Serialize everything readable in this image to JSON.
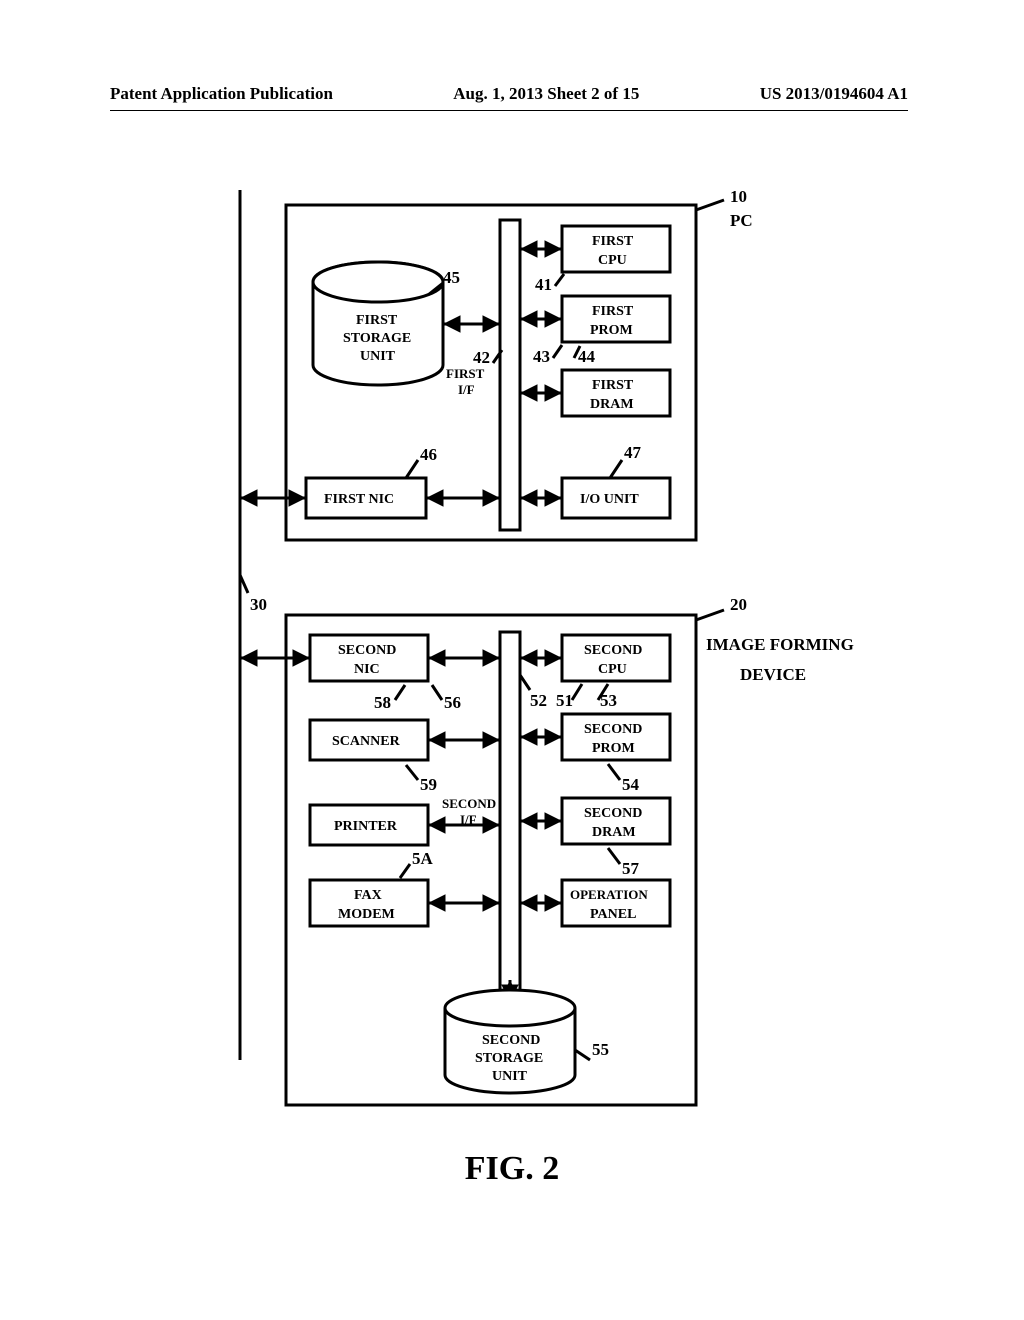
{
  "header": {
    "left": "Patent Application Publication",
    "center": "Aug. 1, 2013  Sheet 2 of 15",
    "right": "US 2013/0194604 A1"
  },
  "figure_caption": "FIG. 2",
  "diagram": {
    "network_ref": "30",
    "pc": {
      "ref": "10",
      "label": "PC",
      "interface": {
        "ref": "42",
        "label1": "FIRST",
        "label2": "I/F"
      },
      "storage": {
        "ref": "45",
        "label1": "FIRST",
        "label2": "STORAGE",
        "label3": "UNIT"
      },
      "cpu": {
        "ref": "41",
        "label1": "FIRST",
        "label2": "CPU"
      },
      "prom": {
        "ref": "43",
        "label1": "FIRST",
        "label2": "PROM"
      },
      "prom_dash": "44",
      "dram": {
        "label1": "FIRST",
        "label2": "DRAM"
      },
      "iounit": {
        "ref": "47",
        "label": "I/O UNIT"
      },
      "nic": {
        "ref": "46",
        "label": "FIRST NIC"
      }
    },
    "ifd": {
      "ref": "20",
      "label1": "IMAGE FORMING",
      "label2": "DEVICE",
      "interface": {
        "ref": "52",
        "label1": "SECOND",
        "label2": "I/F"
      },
      "nic": {
        "ref": "56",
        "ref2": "58",
        "label1": "SECOND",
        "label2": "NIC"
      },
      "scanner": {
        "ref": "59",
        "label": "SCANNER"
      },
      "printer": {
        "label": "PRINTER"
      },
      "fax": {
        "ref": "5A",
        "label1": "FAX",
        "label2": "MODEM"
      },
      "cpu": {
        "ref": "51",
        "label1": "SECOND",
        "label2": "CPU"
      },
      "prom": {
        "ref": "53",
        "label1": "SECOND",
        "label2": "PROM"
      },
      "dram": {
        "ref": "54",
        "label1": "SECOND",
        "label2": "DRAM"
      },
      "op": {
        "ref": "57",
        "label1": "OPERATION",
        "label2": "PANEL"
      },
      "storage": {
        "ref": "55",
        "label1": "SECOND",
        "label2": "STORAGE",
        "label3": "UNIT"
      }
    }
  }
}
